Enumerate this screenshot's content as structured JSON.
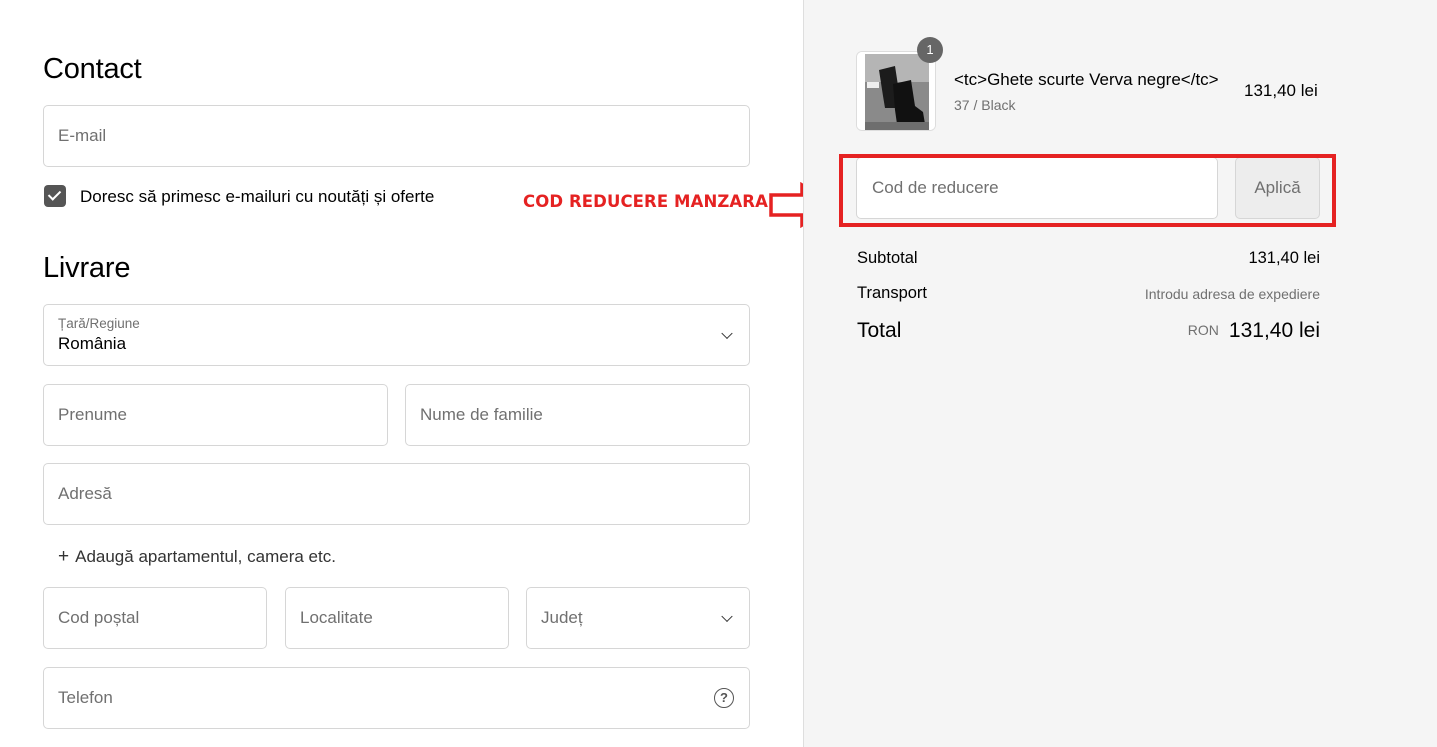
{
  "contact": {
    "heading": "Contact",
    "email_placeholder": "E-mail",
    "newsletter_label": "Doresc să primesc e-mailuri cu noutăți și oferte",
    "newsletter_checked": true
  },
  "delivery": {
    "heading": "Livrare",
    "country_label": "Țară/Regiune",
    "country_value": "România",
    "first_name_placeholder": "Prenume",
    "last_name_placeholder": "Nume de familie",
    "address_placeholder": "Adresă",
    "add_apartment_label": "Adaugă apartamentul, camera etc.",
    "postal_code_placeholder": "Cod poștal",
    "city_placeholder": "Localitate",
    "county_placeholder": "Județ",
    "phone_placeholder": "Telefon"
  },
  "annotation": {
    "text": "COD REDUCERE MANZARA",
    "color": "#e52222"
  },
  "order": {
    "product": {
      "name": "<tc>Ghete scurte Verva negre</tc>",
      "variant": "37 / Black",
      "price": "131,40 lei",
      "quantity": "1"
    },
    "discount": {
      "placeholder": "Cod de reducere",
      "apply_label": "Aplică"
    },
    "summary": {
      "subtotal_label": "Subtotal",
      "subtotal_value": "131,40 lei",
      "shipping_label": "Transport",
      "shipping_value": "Introdu adresa de expediere",
      "total_label": "Total",
      "total_currency": "RON",
      "total_value": "131,40 lei"
    }
  },
  "icons": {
    "country_dropdown": "chevron-down-icon",
    "county_dropdown": "chevron-down-icon",
    "phone_help": "question-circle-icon",
    "checkbox": "checkmark-icon",
    "annotation_arrow": "right-arrow-icon"
  }
}
